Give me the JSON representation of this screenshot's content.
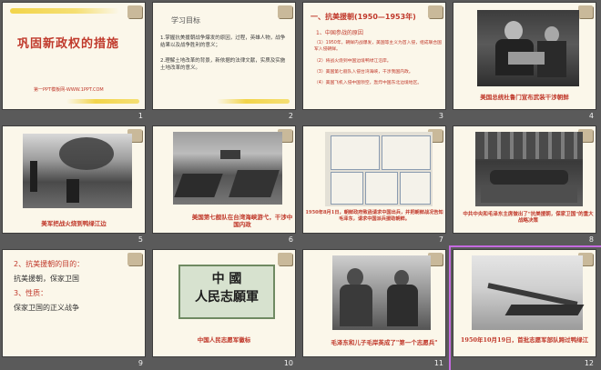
{
  "slides": [
    {
      "num": "1",
      "title": "巩固新政权的措施",
      "link": "第一PPT模板网-WWW.1PPT.COM"
    },
    {
      "num": "2",
      "heading": "学习目标",
      "points": [
        "1.掌握抗美援朝战争爆发的原因，过程，英雄人物，战争结果以及战争胜利的意义；",
        "2.理解土地改革的背景，新依据的法律文献，实质及实施土地改革的意义。"
      ]
    },
    {
      "num": "3",
      "title": "一、抗美援朝(1950—1953年)",
      "subtitle": "1、中国参战的原因",
      "points": [
        "（1）1950年，朝鲜内战爆发，美国等主义为首入侵，组成联合国军入侵朝鲜。",
        "（2）将战火烧到中国边境鸭绿江沿岸。",
        "（3）美国第七舰队入侵台湾海峡，干涉我国内政。",
        "（4）美国飞机入侵中国领空，轰炸中国东北边境地区。"
      ]
    },
    {
      "num": "4",
      "caption": "美国总统杜鲁门宣布武装干涉朝鲜"
    },
    {
      "num": "5",
      "caption": "美军把战火烧到鸭绿江边"
    },
    {
      "num": "6",
      "caption": "美国第七舰队在台湾海峡游弋，干涉中国内政"
    },
    {
      "num": "7",
      "caption": "1950年8月1日，朝鲜政府致函请求中国出兵，并把朝鲜战况告知毛泽东，请求中国派兵援助朝鲜。"
    },
    {
      "num": "8",
      "caption": "中共中央和毛泽东主席做出了\"抗美援朝，保家卫国\"的重大战略决策"
    },
    {
      "num": "9",
      "lines": [
        "2、抗美援朝的目的：",
        "抗美援朝，保家卫国",
        "3、性质：",
        "保家卫国的正义战争"
      ]
    },
    {
      "num": "10",
      "banner": [
        "中 國",
        "人民志願軍"
      ],
      "caption": "中国人民志愿军徽标"
    },
    {
      "num": "11",
      "caption": "毛泽东和儿子毛岸英成了\"第一个志愿兵\""
    },
    {
      "num": "12",
      "caption": "1950年10月19日，首批志愿军部队跨过鸭绿江"
    }
  ],
  "colors": {
    "background": "#5a5a5a",
    "slide": "#fbf7ea",
    "accent": "#c0392b",
    "highlight": "#f2d44a",
    "selection": "#c56be0"
  }
}
